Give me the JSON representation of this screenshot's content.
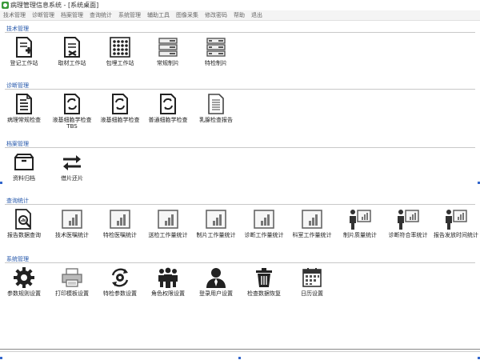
{
  "window": {
    "title": "病理管理信息系统 - [系统桌面]"
  },
  "menu": [
    "技术管理",
    "诊断管理",
    "档案管理",
    "查询统计",
    "系统管理",
    "辅助工具",
    "图像采集",
    "修改密码",
    "帮助",
    "退出"
  ],
  "sections": [
    {
      "title": "技术管理",
      "items": [
        {
          "label": "登记工作站",
          "icon": "register-icon"
        },
        {
          "label": "取材工作站",
          "icon": "sampling-icon"
        },
        {
          "label": "包埋工作站",
          "icon": "embedding-grid-icon"
        },
        {
          "label": "常规制片",
          "icon": "slide-stack-icon"
        },
        {
          "label": "特检制片",
          "icon": "special-slide-stack-icon"
        }
      ]
    },
    {
      "title": "诊断管理",
      "items": [
        {
          "label": "病理常规检查",
          "icon": "report-document-icon"
        },
        {
          "label": "液基细胞学检查TBS",
          "icon": "cytology-icon"
        },
        {
          "label": "液基细胞学检查",
          "icon": "cytology-icon"
        },
        {
          "label": "普通细胞学检查",
          "icon": "cytology-icon"
        },
        {
          "label": "乳腺检查报告",
          "icon": "breast-report-icon"
        }
      ]
    },
    {
      "title": "档案管理",
      "items": [
        {
          "label": "资料归档",
          "icon": "archive-tray-icon"
        },
        {
          "label": "借片还片",
          "icon": "exchange-arrows-icon"
        }
      ]
    },
    {
      "title": "查询统计",
      "items": [
        {
          "label": "报告数据查询",
          "icon": "search-report-icon"
        },
        {
          "label": "技术医嘱统计",
          "icon": "bar-chart-icon"
        },
        {
          "label": "特检医嘱统计",
          "icon": "bar-chart-icon"
        },
        {
          "label": "送检工作量统计",
          "icon": "bar-chart-icon"
        },
        {
          "label": "制片工作量统计",
          "icon": "bar-chart-icon"
        },
        {
          "label": "诊断工作量统计",
          "icon": "bar-chart-icon"
        },
        {
          "label": "科室工作量统计",
          "icon": "bar-chart-icon"
        },
        {
          "label": "制片质量统计",
          "icon": "presenter-chart-icon"
        },
        {
          "label": "诊断符合率统计",
          "icon": "presenter-chart-icon"
        },
        {
          "label": "报告发放时间统计",
          "icon": "presenter-chart-icon"
        }
      ]
    },
    {
      "title": "系统管理",
      "items": [
        {
          "label": "参数规则设置",
          "icon": "gear-icon"
        },
        {
          "label": "打印模板设置",
          "icon": "printer-icon"
        },
        {
          "label": "特检参数设置",
          "icon": "cycle-gear-icon"
        },
        {
          "label": "角色权限设置",
          "icon": "users-group-icon"
        },
        {
          "label": "登录用户设置",
          "icon": "user-icon"
        },
        {
          "label": "检查数据恢复",
          "icon": "trash-icon"
        },
        {
          "label": "日历设置",
          "icon": "calendar-icon"
        }
      ]
    }
  ]
}
